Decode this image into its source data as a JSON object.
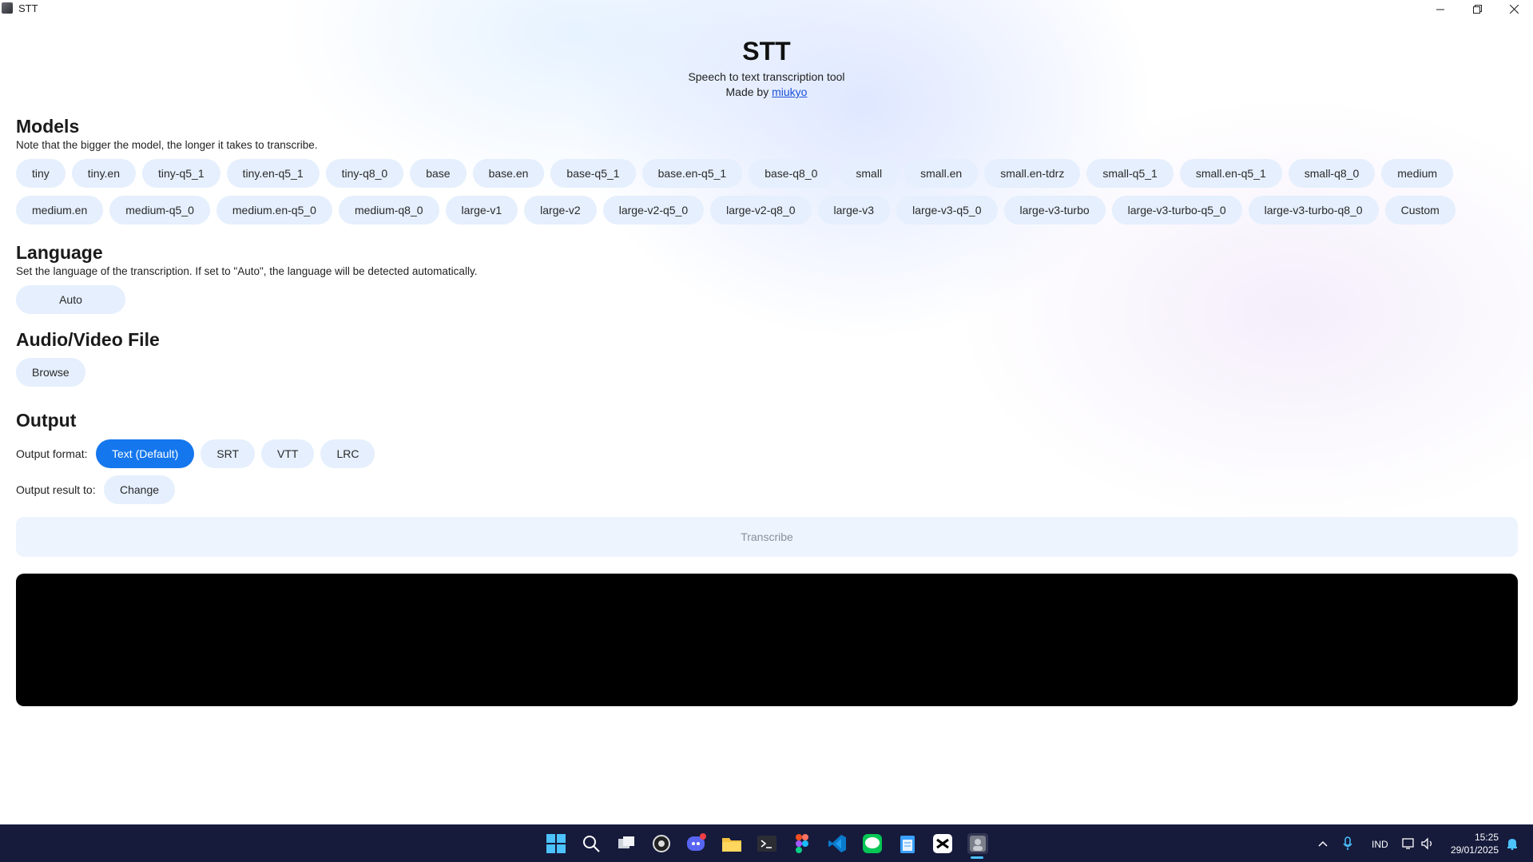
{
  "window": {
    "title": "STT"
  },
  "header": {
    "title": "STT",
    "subtitle": "Speech to text transcription tool",
    "made_by_prefix": "Made by ",
    "made_by_link": "miukyo"
  },
  "models": {
    "heading": "Models",
    "note": "Note that the bigger the model, the longer it takes to transcribe.",
    "row1": [
      "tiny",
      "tiny.en",
      "tiny-q5_1",
      "tiny.en-q5_1",
      "tiny-q8_0",
      "base",
      "base.en",
      "base-q5_1",
      "base.en-q5_1",
      "base-q8_0",
      "small",
      "small.en",
      "small.en-tdrz",
      "small-q5_1",
      "small.en-q5_1",
      "small-q8_0",
      "medium"
    ],
    "row2": [
      "medium.en",
      "medium-q5_0",
      "medium.en-q5_0",
      "medium-q8_0",
      "large-v1",
      "large-v2",
      "large-v2-q5_0",
      "large-v2-q8_0",
      "large-v3",
      "large-v3-q5_0",
      "large-v3-turbo",
      "large-v3-turbo-q5_0",
      "large-v3-turbo-q8_0",
      "Custom"
    ]
  },
  "language": {
    "heading": "Language",
    "note": "Set the language of the transcription. If set to \"Auto\", the language will be detected automatically.",
    "value": "Auto"
  },
  "file": {
    "heading": "Audio/Video File",
    "browse_label": "Browse"
  },
  "output": {
    "heading": "Output",
    "format_label": "Output format:",
    "formats": [
      "Text (Default)",
      "SRT",
      "VTT",
      "LRC"
    ],
    "selected_format": "Text (Default)",
    "result_label": "Output result to:",
    "change_label": "Change"
  },
  "transcribe_label": "Transcribe",
  "colors": {
    "accent": "#1477ee",
    "pill_bg": "#e5effd",
    "taskbar": "#161b3c"
  },
  "taskbar": {
    "icons": [
      "windows-start-icon",
      "search-icon",
      "task-view-icon",
      "obs-icon",
      "discord-icon",
      "file-explorer-icon",
      "terminal-icon",
      "figma-icon",
      "vscode-icon",
      "line-icon",
      "notepad-icon",
      "capcut-icon",
      "stt-app-icon"
    ],
    "language": "IND",
    "time": "15:25",
    "date": "29/01/2025"
  }
}
